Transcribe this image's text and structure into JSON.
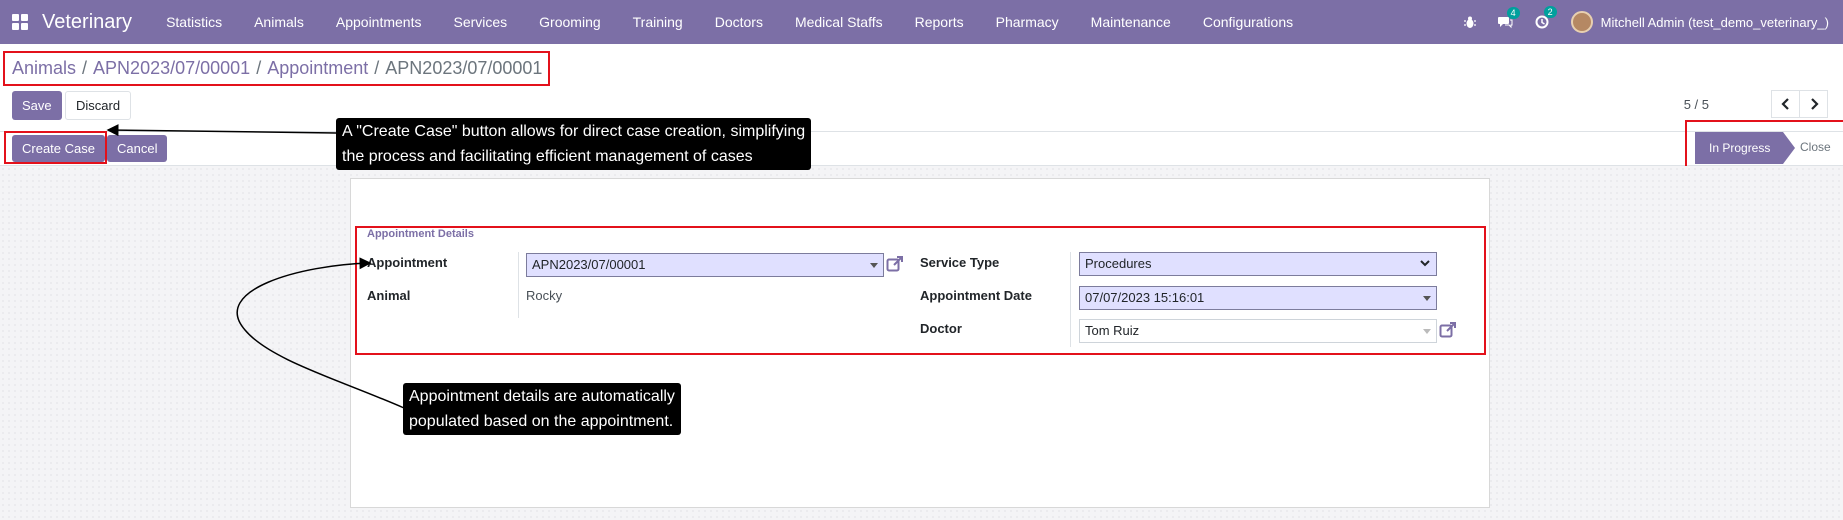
{
  "navbar": {
    "brand": "Veterinary",
    "menu": [
      "Statistics",
      "Animals",
      "Appointments",
      "Services",
      "Grooming",
      "Training",
      "Doctors",
      "Medical Staffs",
      "Reports",
      "Pharmacy",
      "Maintenance",
      "Configurations"
    ],
    "messages_count": "4",
    "activities_count": "2",
    "user": "Mitchell Admin (test_demo_veterinary_)"
  },
  "breadcrumb": {
    "items": [
      "Animals",
      "APN2023/07/00001",
      "Appointment"
    ],
    "current": "APN2023/07/00001"
  },
  "toolbar": {
    "save_label": "Save",
    "discard_label": "Discard",
    "pager": "5 / 5"
  },
  "actions": {
    "create_case_label": "Create Case",
    "cancel_label": "Cancel"
  },
  "status": {
    "active": "In Progress",
    "next": "Close"
  },
  "form": {
    "section_title": "Appointment Details",
    "appointment_label": "Appointment",
    "appointment_value": "APN2023/07/00001",
    "animal_label": "Animal",
    "animal_value": "Rocky",
    "service_type_label": "Service Type",
    "service_type_value": "Procedures",
    "appointment_date_label": "Appointment Date",
    "appointment_date_value": "07/07/2023 15:16:01",
    "doctor_label": "Doctor",
    "doctor_value": "Tom Ruiz"
  },
  "annotations": {
    "create_case_tip_line1": "A \"Create Case\" button allows for direct case creation, simplifying",
    "create_case_tip_line2": "the process and facilitating efficient management of cases",
    "details_tip_line1": "Appointment details are automatically",
    "details_tip_line2": "populated based on the appointment.",
    "annotation_color": "#e3111b"
  }
}
